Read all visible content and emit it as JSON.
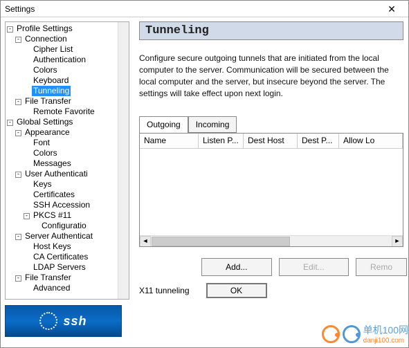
{
  "window": {
    "title": "Settings"
  },
  "tree": {
    "profile_settings": "Profile Settings",
    "connection": "Connection",
    "cipher_list": "Cipher List",
    "authentication": "Authentication",
    "colors": "Colors",
    "keyboard": "Keyboard",
    "tunneling": "Tunneling",
    "file_transfer": "File Transfer",
    "remote_favorite": "Remote Favorite",
    "global_settings": "Global Settings",
    "appearance": "Appearance",
    "font": "Font",
    "colors2": "Colors",
    "messages": "Messages",
    "user_auth": "User Authenticati",
    "keys": "Keys",
    "certificates": "Certificates",
    "ssh_accession": "SSH Accession",
    "pkcs11": "PKCS #11",
    "configuration": "Configuratio",
    "server_auth": "Server Authenticat",
    "host_keys": "Host Keys",
    "ca_certs": "CA Certificates",
    "ldap": "LDAP Servers",
    "file_transfer2": "File Transfer",
    "advanced": "Advanced"
  },
  "panel": {
    "title": "Tunneling",
    "description": "Configure secure outgoing tunnels that are initiated from the local computer to the server. Communication will be secured between the local computer and the server, but insecure beyond the server. The settings will take effect upon next login."
  },
  "tabs": {
    "outgoing": "Outgoing",
    "incoming": "Incoming"
  },
  "columns": {
    "name": "Name",
    "listen_port": "Listen P...",
    "dest_host": "Dest Host",
    "dest_port": "Dest P...",
    "allow_local": "Allow Lo"
  },
  "buttons": {
    "add": "Add...",
    "edit": "Edit...",
    "remove": "Remo",
    "ok": "OK"
  },
  "footer": {
    "x11": "X11 tunneling"
  },
  "logo": {
    "text": "ssh"
  },
  "watermark": {
    "name": "单机100网",
    "url": "danji100.com"
  }
}
